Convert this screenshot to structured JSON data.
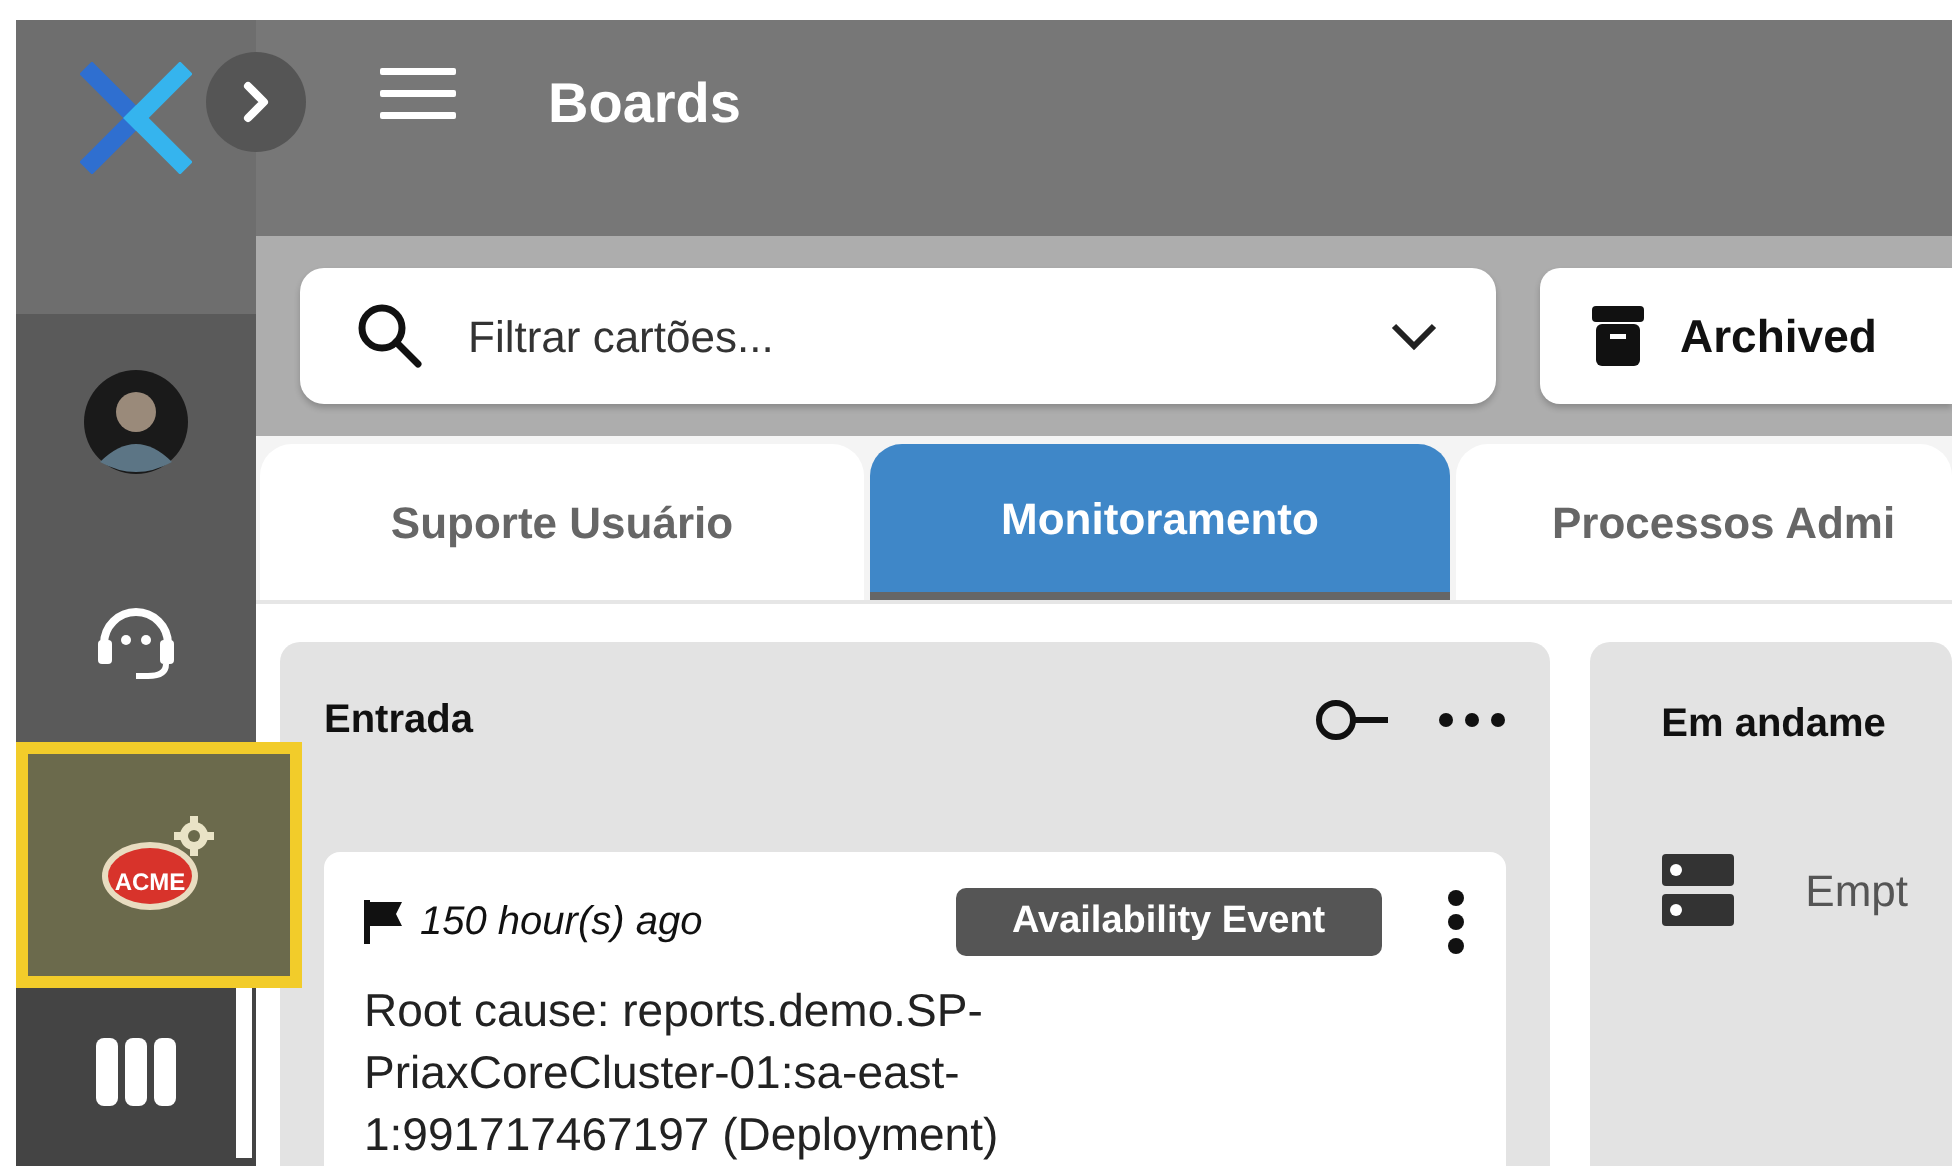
{
  "sidebar": {
    "items": [
      {
        "kind": "avatar",
        "selected": false
      },
      {
        "kind": "support",
        "selected": false
      },
      {
        "kind": "company",
        "logo_text": "ACME",
        "selected": true
      },
      {
        "kind": "boards",
        "selected": false
      }
    ]
  },
  "header": {
    "title": "Boards"
  },
  "filter": {
    "placeholder": "Filtrar cartões...",
    "archived_button": "Archived"
  },
  "tabs": [
    {
      "label": "Suporte Usuário",
      "selected": false
    },
    {
      "label": "Monitoramento",
      "selected": true
    },
    {
      "label": "Processos Admi",
      "selected": false
    }
  ],
  "columns": [
    {
      "title": "Entrada",
      "cards": [
        {
          "time": "150 hour(s) ago",
          "tag": "Availability Event",
          "text": "Root cause: reports.demo.SP-PriaxCoreCluster-01:sa-east-1:991717467197 (Deployment)"
        }
      ]
    },
    {
      "title": "Em andame",
      "empty_text": "Empt"
    }
  ]
}
